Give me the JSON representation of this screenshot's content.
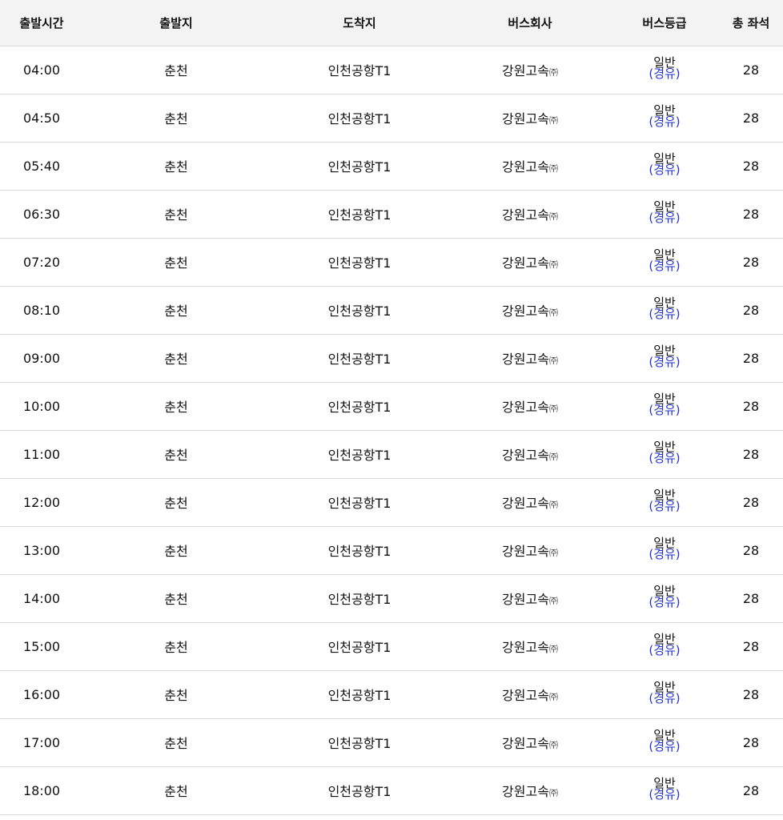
{
  "table": {
    "headers": {
      "time": "출발시간",
      "origin": "출발지",
      "destination": "도착지",
      "company": "버스회사",
      "grade": "버스등급",
      "seats": "총 좌석"
    },
    "rows": [
      {
        "time": "04:00",
        "origin": "춘천",
        "destination": "인천공항T1",
        "company": "강원고속",
        "company_suffix": "㈜",
        "grade": "일반",
        "grade_note": "(경유)",
        "seats": "28"
      },
      {
        "time": "04:50",
        "origin": "춘천",
        "destination": "인천공항T1",
        "company": "강원고속",
        "company_suffix": "㈜",
        "grade": "일반",
        "grade_note": "(경유)",
        "seats": "28"
      },
      {
        "time": "05:40",
        "origin": "춘천",
        "destination": "인천공항T1",
        "company": "강원고속",
        "company_suffix": "㈜",
        "grade": "일반",
        "grade_note": "(경유)",
        "seats": "28"
      },
      {
        "time": "06:30",
        "origin": "춘천",
        "destination": "인천공항T1",
        "company": "강원고속",
        "company_suffix": "㈜",
        "grade": "일반",
        "grade_note": "(경유)",
        "seats": "28"
      },
      {
        "time": "07:20",
        "origin": "춘천",
        "destination": "인천공항T1",
        "company": "강원고속",
        "company_suffix": "㈜",
        "grade": "일반",
        "grade_note": "(경유)",
        "seats": "28"
      },
      {
        "time": "08:10",
        "origin": "춘천",
        "destination": "인천공항T1",
        "company": "강원고속",
        "company_suffix": "㈜",
        "grade": "일반",
        "grade_note": "(경유)",
        "seats": "28"
      },
      {
        "time": "09:00",
        "origin": "춘천",
        "destination": "인천공항T1",
        "company": "강원고속",
        "company_suffix": "㈜",
        "grade": "일반",
        "grade_note": "(경유)",
        "seats": "28"
      },
      {
        "time": "10:00",
        "origin": "춘천",
        "destination": "인천공항T1",
        "company": "강원고속",
        "company_suffix": "㈜",
        "grade": "일반",
        "grade_note": "(경유)",
        "seats": "28"
      },
      {
        "time": "11:00",
        "origin": "춘천",
        "destination": "인천공항T1",
        "company": "강원고속",
        "company_suffix": "㈜",
        "grade": "일반",
        "grade_note": "(경유)",
        "seats": "28"
      },
      {
        "time": "12:00",
        "origin": "춘천",
        "destination": "인천공항T1",
        "company": "강원고속",
        "company_suffix": "㈜",
        "grade": "일반",
        "grade_note": "(경유)",
        "seats": "28"
      },
      {
        "time": "13:00",
        "origin": "춘천",
        "destination": "인천공항T1",
        "company": "강원고속",
        "company_suffix": "㈜",
        "grade": "일반",
        "grade_note": "(경유)",
        "seats": "28"
      },
      {
        "time": "14:00",
        "origin": "춘천",
        "destination": "인천공항T1",
        "company": "강원고속",
        "company_suffix": "㈜",
        "grade": "일반",
        "grade_note": "(경유)",
        "seats": "28"
      },
      {
        "time": "15:00",
        "origin": "춘천",
        "destination": "인천공항T1",
        "company": "강원고속",
        "company_suffix": "㈜",
        "grade": "일반",
        "grade_note": "(경유)",
        "seats": "28"
      },
      {
        "time": "16:00",
        "origin": "춘천",
        "destination": "인천공항T1",
        "company": "강원고속",
        "company_suffix": "㈜",
        "grade": "일반",
        "grade_note": "(경유)",
        "seats": "28"
      },
      {
        "time": "17:00",
        "origin": "춘천",
        "destination": "인천공항T1",
        "company": "강원고속",
        "company_suffix": "㈜",
        "grade": "일반",
        "grade_note": "(경유)",
        "seats": "28"
      },
      {
        "time": "18:00",
        "origin": "춘천",
        "destination": "인천공항T1",
        "company": "강원고속",
        "company_suffix": "㈜",
        "grade": "일반",
        "grade_note": "(경유)",
        "seats": "28"
      }
    ]
  },
  "colors": {
    "header_bg": "#f3f3f3",
    "row_border": "#dddddd",
    "grade_note": "#2233cc"
  }
}
